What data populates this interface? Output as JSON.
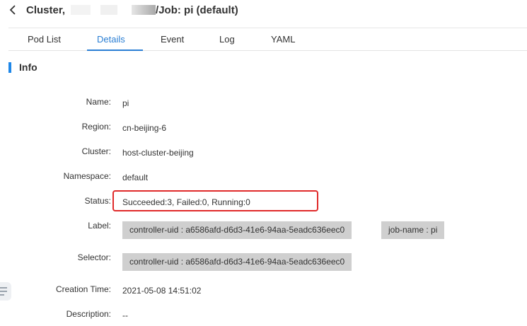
{
  "header": {
    "back_icon": "chevron-left-icon",
    "title_prefix": "Cluster,",
    "title_suffix": "/Job: pi (default)"
  },
  "tabs": [
    {
      "label": "Pod List",
      "active": false
    },
    {
      "label": "Details",
      "active": true
    },
    {
      "label": "Event",
      "active": false
    },
    {
      "label": "Log",
      "active": false
    },
    {
      "label": "YAML",
      "active": false
    }
  ],
  "section": {
    "title": "Info"
  },
  "info": {
    "name_label": "Name:",
    "name": "pi",
    "region_label": "Region:",
    "region": "cn-beijing-6",
    "cluster_label": "Cluster:",
    "cluster": "host-cluster-beijing",
    "namespace_label": "Namespace:",
    "namespace": "default",
    "status_label": "Status:",
    "status": "Succeeded:3, Failed:0, Running:0",
    "label_label": "Label:",
    "labels": [
      "controller-uid : a6586afd-d6d3-41e6-94aa-5eadc636eec0",
      "job-name : pi"
    ],
    "selector_label": "Selector:",
    "selectors": [
      "controller-uid : a6586afd-d6d3-41e6-94aa-5eadc636eec0"
    ],
    "creation_time_label": "Creation Time:",
    "creation_time": "2021-05-08 14:51:02",
    "description_label": "Description:",
    "description": "--"
  },
  "colors": {
    "accent": "#2b7fd4",
    "highlight_border": "#e02a2a",
    "tag_bg": "#cfcfcf"
  }
}
